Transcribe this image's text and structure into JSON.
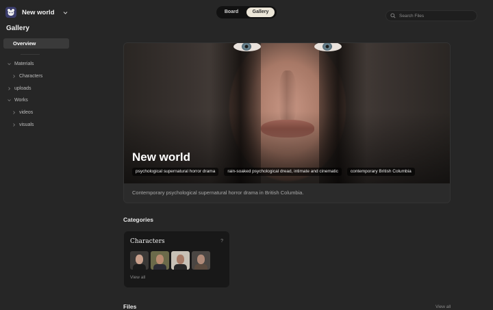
{
  "app": {
    "project_name": "New world"
  },
  "sidebar": {
    "section_title": "Gallery",
    "active_item": "Overview",
    "tree": [
      {
        "label": "Materials"
      },
      {
        "label": "Characters"
      },
      {
        "label": "uploads"
      },
      {
        "label": "Works"
      },
      {
        "label": "videos"
      },
      {
        "label": "visuals"
      }
    ]
  },
  "view_toggle": {
    "options": [
      "Board",
      "Gallery"
    ],
    "selected": "Gallery"
  },
  "search": {
    "placeholder": "Search Files"
  },
  "hero": {
    "title": "New world",
    "tags": [
      "psychological supernatural horror drama",
      "rain-soaked psychological dread, intimate and cinematic",
      "contemporary British Columbia"
    ],
    "description": "Contemporary psychological supernatural horror drama in British Columbia."
  },
  "categories": {
    "heading": "Categories",
    "cards": [
      {
        "title": "Characters",
        "help": "?",
        "link": "View all"
      }
    ]
  },
  "files": {
    "heading": "Files",
    "link": "View all"
  },
  "colors": {
    "background": "#262626",
    "active_nav": "#3a3a3a",
    "toggle_selected": "#ece6d8",
    "card": "#181818"
  }
}
